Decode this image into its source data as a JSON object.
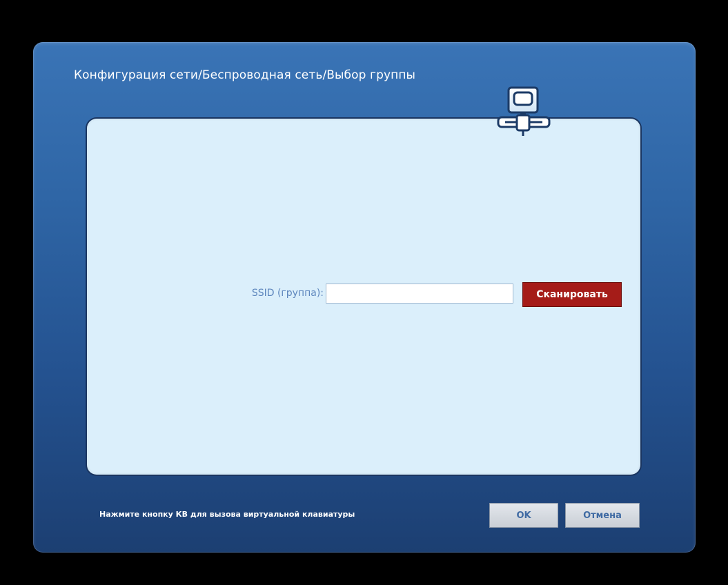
{
  "dialog": {
    "title": "Конфигурация сети/Беспроводная сеть/Выбор группы",
    "icon": "network-computer-icon"
  },
  "ssid": {
    "label": "SSID (группа):",
    "value": "",
    "placeholder": ""
  },
  "buttons": {
    "scan_label": "Сканировать",
    "ok_label": "OK",
    "cancel_label": "Отмена"
  },
  "footer": {
    "hint": "Нажмите кнопку КВ для вызова виртуальной клавиатуры"
  },
  "colors": {
    "dialog_bg": "#2f66a6",
    "panel_bg": "#dbeffb",
    "scan_button": "#a51c18",
    "label_text": "#5d86bd",
    "button_text": "#3f6aa3"
  }
}
